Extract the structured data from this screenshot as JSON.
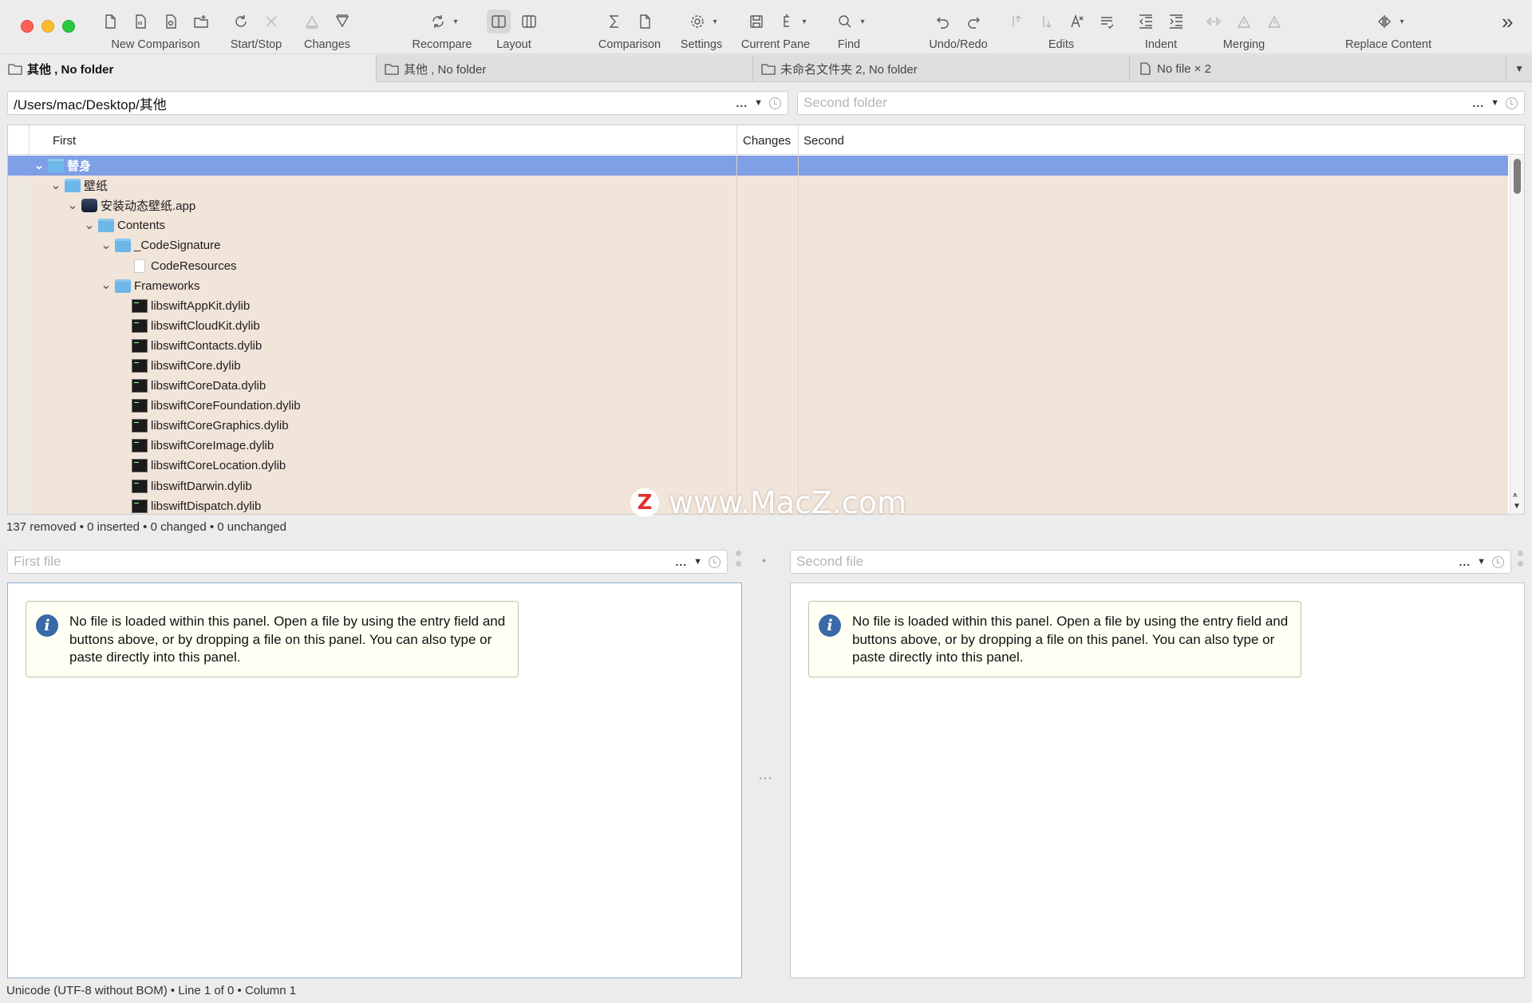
{
  "toolbar": {
    "groups": [
      {
        "label": "New Comparison"
      },
      {
        "label": "Start/Stop"
      },
      {
        "label": "Changes"
      },
      {
        "label": "Recompare"
      },
      {
        "label": "Layout"
      },
      {
        "label": "Comparison"
      },
      {
        "label": "Settings"
      },
      {
        "label": "Current Pane"
      },
      {
        "label": "Find"
      },
      {
        "label": "Undo/Redo"
      },
      {
        "label": "Edits"
      },
      {
        "label": "Indent"
      },
      {
        "label": "Merging"
      },
      {
        "label": "Replace Content"
      }
    ],
    "overflow": "»"
  },
  "tabs": [
    {
      "label": "其他 , No folder",
      "icon": "folder-tab-icon",
      "active": true
    },
    {
      "label": "其他 , No folder",
      "icon": "folder-tab-icon",
      "active": false
    },
    {
      "label": "未命名文件夹 2, No folder",
      "icon": "folder-tab-icon",
      "active": false
    },
    {
      "label": "No file × 2",
      "icon": "file-tab-icon",
      "active": false
    }
  ],
  "tab_overflow": "▼",
  "first_folder": {
    "value": "/Users/mac/Desktop/其他",
    "dots": "...",
    "arrow": "▼"
  },
  "second_folder": {
    "placeholder": "Second folder",
    "dots": "...",
    "arrow": "▼"
  },
  "tree": {
    "columns": {
      "first": "First",
      "changes": "Changes",
      "second": "Second"
    },
    "rows": [
      {
        "name": "替身",
        "depth": 0,
        "type": "folder",
        "expanded": true,
        "selected": true
      },
      {
        "name": "壁纸",
        "depth": 1,
        "type": "folder",
        "expanded": true
      },
      {
        "name": "安装动态壁纸.app",
        "depth": 2,
        "type": "app",
        "expanded": true
      },
      {
        "name": "Contents",
        "depth": 3,
        "type": "folder",
        "expanded": true
      },
      {
        "name": "_CodeSignature",
        "depth": 4,
        "type": "folder",
        "expanded": true
      },
      {
        "name": "CodeResources",
        "depth": 5,
        "type": "doc"
      },
      {
        "name": "Frameworks",
        "depth": 4,
        "type": "folder",
        "expanded": true
      },
      {
        "name": "libswiftAppKit.dylib",
        "depth": 5,
        "type": "dylib"
      },
      {
        "name": "libswiftCloudKit.dylib",
        "depth": 5,
        "type": "dylib"
      },
      {
        "name": "libswiftContacts.dylib",
        "depth": 5,
        "type": "dylib"
      },
      {
        "name": "libswiftCore.dylib",
        "depth": 5,
        "type": "dylib"
      },
      {
        "name": "libswiftCoreData.dylib",
        "depth": 5,
        "type": "dylib"
      },
      {
        "name": "libswiftCoreFoundation.dylib",
        "depth": 5,
        "type": "dylib"
      },
      {
        "name": "libswiftCoreGraphics.dylib",
        "depth": 5,
        "type": "dylib"
      },
      {
        "name": "libswiftCoreImage.dylib",
        "depth": 5,
        "type": "dylib"
      },
      {
        "name": "libswiftCoreLocation.dylib",
        "depth": 5,
        "type": "dylib"
      },
      {
        "name": "libswiftDarwin.dylib",
        "depth": 5,
        "type": "dylib"
      },
      {
        "name": "libswiftDispatch.dylib",
        "depth": 5,
        "type": "dylib"
      }
    ]
  },
  "folder_status": "137 removed • 0 inserted • 0 changed • 0 unchanged",
  "watermark": {
    "logo": "Z",
    "text": "www.MacZ.com"
  },
  "first_file": {
    "placeholder": "First file",
    "dots": "...",
    "arrow": "▼"
  },
  "second_file": {
    "placeholder": "Second file",
    "dots": "...",
    "arrow": "▼"
  },
  "middle_gutter": {
    "top": "•",
    "center": "⋯"
  },
  "notice_text": "No file is loaded within this panel. Open a file by using the entry field and buttons above, or by dropping a file on this panel. You can also type or paste directly into this panel.",
  "file_status": "Unicode (UTF-8 without BOM) • Line 1 of 0 • Column 1",
  "colors": {
    "selected_row": "#7f9fe6",
    "removed_row": "#f1e4d9",
    "info_icon": "#3a69a8"
  }
}
